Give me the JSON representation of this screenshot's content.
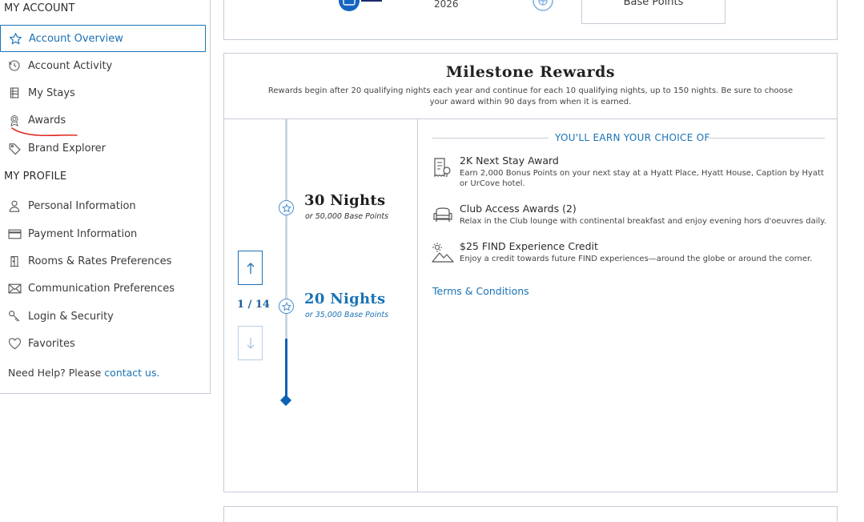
{
  "sidebar": {
    "account_heading": "MY ACCOUNT",
    "account_items": [
      {
        "label": "Account Overview",
        "icon": "star-icon",
        "active": true
      },
      {
        "label": "Account Activity",
        "icon": "history-icon"
      },
      {
        "label": "My Stays",
        "icon": "hotel-icon"
      },
      {
        "label": "Awards",
        "icon": "award-ribbon-icon"
      },
      {
        "label": "Brand Explorer",
        "icon": "tag-icon"
      }
    ],
    "profile_heading": "MY PROFILE",
    "profile_items": [
      {
        "label": "Personal Information",
        "icon": "person-icon"
      },
      {
        "label": "Payment Information",
        "icon": "credit-card-icon"
      },
      {
        "label": "Rooms & Rates Preferences",
        "icon": "door-icon"
      },
      {
        "label": "Communication Preferences",
        "icon": "envelope-icon"
      },
      {
        "label": "Login & Security",
        "icon": "key-icon"
      },
      {
        "label": "Favorites",
        "icon": "heart-icon"
      }
    ],
    "help_text": "Need Help? Please ",
    "help_link": "contact us."
  },
  "top_card": {
    "year": "2026",
    "base_points_label": "Base Points"
  },
  "milestone": {
    "title": "Milestone Rewards",
    "subtitle": "Rewards begin after 20 qualifying nights each year and continue for each 10 qualifying nights, up to 150 nights. Be sure to choose your award within 90 days from when it is earned.",
    "levels": [
      {
        "nights": "30 Nights",
        "sub": "or 50,000 Base Points"
      },
      {
        "nights": "20 Nights",
        "sub": "or 35,000 Base Points"
      }
    ],
    "pager": "1 / 14",
    "earn_heading": "YOU'LL EARN YOUR CHOICE OF",
    "awards": [
      {
        "title": "2K Next Stay Award",
        "desc": "Earn 2,000 Bonus Points on your next stay at a Hyatt Place, Hyatt House, Caption by Hyatt or UrCove hotel.",
        "icon": "receipt-icon"
      },
      {
        "title": "Club Access Awards (2)",
        "desc": "Relax in the Club lounge with continental breakfast and enjoy evening hors d'oeuvres daily.",
        "icon": "armchair-icon"
      },
      {
        "title": "$25 FIND Experience Credit",
        "desc": "Enjoy a credit towards future FIND experiences—around the globe or around the corner.",
        "icon": "mountain-sun-icon"
      }
    ],
    "terms_label": "Terms & Conditions"
  },
  "colors": {
    "accent": "#1a73b5",
    "track_active": "#0d63b3",
    "border": "#c5ccd6",
    "annotation_red": "#e0261b"
  }
}
